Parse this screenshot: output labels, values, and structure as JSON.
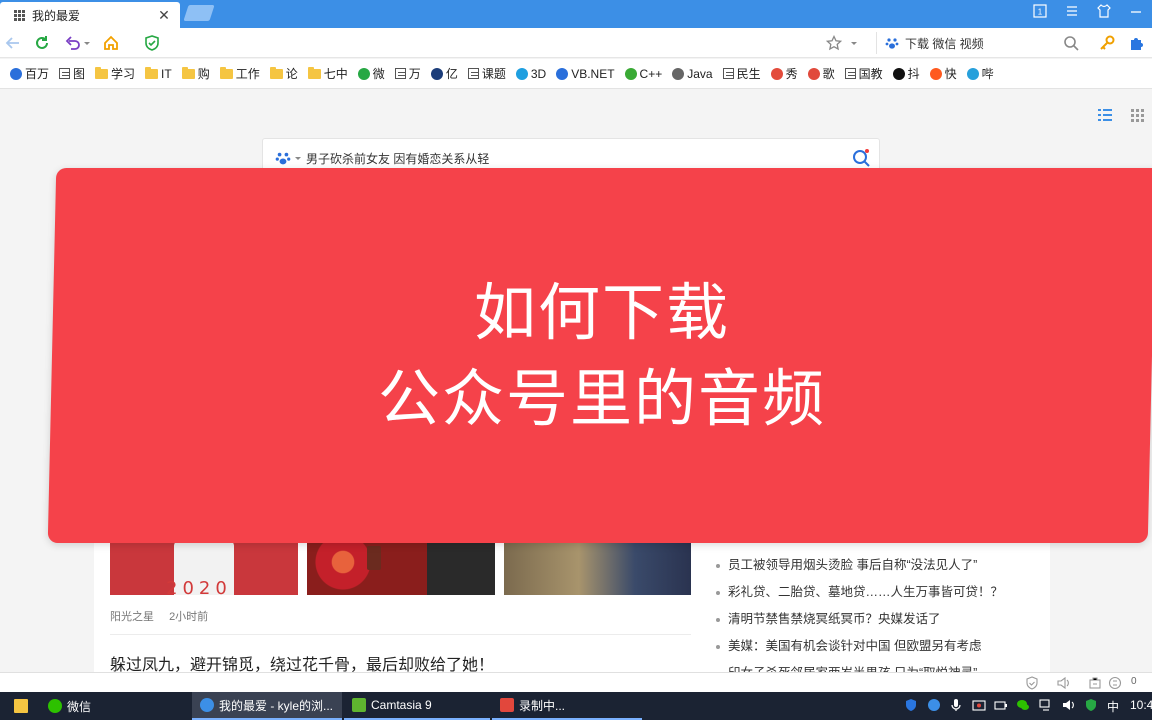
{
  "tab": {
    "title": "我的最爱"
  },
  "navbar": {
    "search_text": "下载 微信 视频"
  },
  "bookmarks": [
    {
      "label": "百万",
      "icon": "baidu-paw-icon",
      "color": "#2a6fdb"
    },
    {
      "label": "图",
      "icon": "doc-icon"
    },
    {
      "label": "学习",
      "icon": "folder-icon"
    },
    {
      "label": "IT",
      "icon": "folder-icon"
    },
    {
      "label": "购",
      "icon": "folder-icon"
    },
    {
      "label": "工作",
      "icon": "folder-icon"
    },
    {
      "label": "论",
      "icon": "folder-icon"
    },
    {
      "label": "七中",
      "icon": "folder-icon"
    },
    {
      "label": "微",
      "icon": "recycle-icon",
      "color": "#27a844"
    },
    {
      "label": "万",
      "icon": "doc-icon"
    },
    {
      "label": "亿",
      "icon": "chart-icon",
      "color": "#1c3d7a"
    },
    {
      "label": "课题",
      "icon": "doc-icon"
    },
    {
      "label": "3D",
      "icon": "send-icon",
      "color": "#1e9fe0"
    },
    {
      "label": "VB.NET",
      "icon": "baidu-paw-icon",
      "color": "#2a6fdb"
    },
    {
      "label": "C++",
      "icon": "wechat-icon",
      "color": "#3aaa35"
    },
    {
      "label": "Java",
      "icon": "globe-icon",
      "color": "#666666"
    },
    {
      "label": "民生",
      "icon": "doc-icon"
    },
    {
      "label": "秀",
      "icon": "colorful-x-icon",
      "color": "#e34b3b"
    },
    {
      "label": "歌",
      "icon": "music-icon",
      "color": "#e14a3c"
    },
    {
      "label": "国教",
      "icon": "doc-icon"
    },
    {
      "label": "抖",
      "icon": "douyin-icon",
      "color": "#111111"
    },
    {
      "label": "快",
      "icon": "kuaishou-icon",
      "color": "#ff5a1f"
    },
    {
      "label": "哔",
      "icon": "bilibili-icon",
      "color": "#27a0db"
    }
  ],
  "content": {
    "search_placeholder": "男子砍杀前女友 因有婚恋关系从轻",
    "feed": {
      "source": "阳光之星",
      "time": "2小时前",
      "headline": "躲过凤九，避开锦觅，绕过花千骨，最后却败给了她！",
      "thumb_caption": "2020"
    },
    "news": [
      "员工被领导用烟头烫脸 事后自称“没法见人了”",
      "彩礼贷、二胎贷、墓地贷……人生万事皆可贷！？",
      "清明节禁售禁烧冥纸冥币？央媒发话了",
      "美媒：美国有机会谈针对中国 但欧盟另有考虑",
      "印女子杀死邻居家两岁半男孩 只为“取悦神灵”"
    ]
  },
  "overlay": {
    "line1": "如何下载",
    "line2": "公众号里的音频",
    "color": "#f5424a"
  },
  "statusbar": {
    "zoom": "0"
  },
  "taskbar": {
    "items": [
      {
        "label": "微信"
      },
      {
        "label": "我的最爱 - kyle的浏..."
      },
      {
        "label": "Camtasia 9"
      },
      {
        "label": "录制中..."
      }
    ],
    "ime": "中",
    "clock": "10:4"
  }
}
